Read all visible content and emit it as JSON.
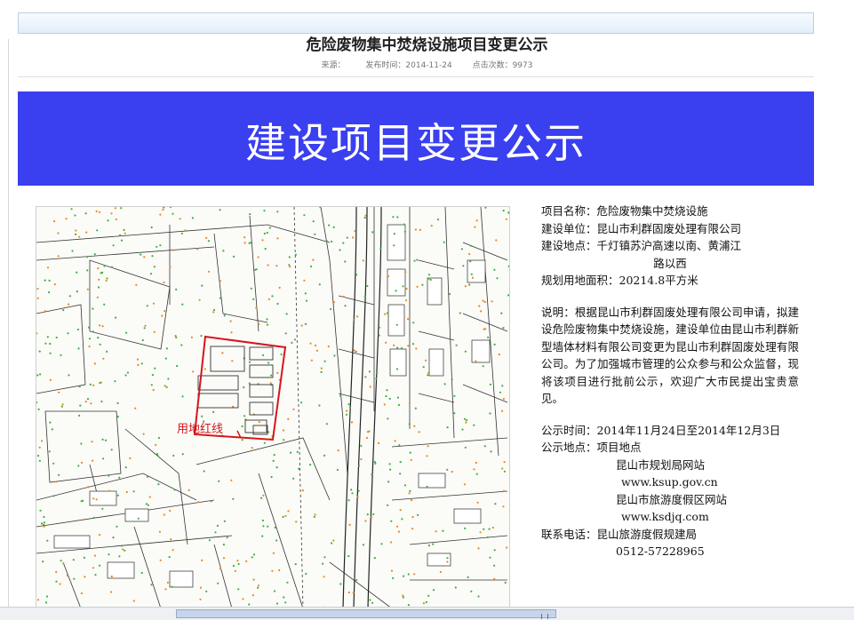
{
  "page": {
    "title": "危险废物集中焚烧设施项目变更公示",
    "meta_source": "来源：",
    "meta_date": "发布时间：2014-11-24",
    "meta_views": "点击次数：9973"
  },
  "banner": {
    "text": "建设项目变更公示"
  },
  "map": {
    "red_line_label": "用地红线"
  },
  "info": {
    "project_name": "项目名称：危险废物集中焚烧设施",
    "builder": "建设单位：昆山市利群固废处理有限公司",
    "location_1": "建设地点：千灯镇苏沪高速以南、黄浦江",
    "location_2": "路以西",
    "area": "规划用地面积：20214.8平方米",
    "explanation": "说明：根据昆山市利群固废处理有限公司申请，拟建设危险废物集中焚烧设施，建设单位由昆山市利群新型墙体材料有限公司变更为昆山市利群固废处理有限公司。为了加强城市管理的公众参与和公众监督，现将该项目进行批前公示，欢迎广大市民提出宝贵意见。",
    "time": "公示时间：2014年11月24日至2014年12月3日",
    "place_label": "公示地点：项目地点",
    "place_2": "昆山市规划局网站",
    "place_2_url": "www.ksup.gov.cn",
    "place_3": "昆山市旅游度假区网站",
    "place_3_url": "www.ksdjq.com",
    "phone_label": "联系电话：昆山旅游度假规建局",
    "phone": "0512-57228965"
  },
  "colors": {
    "banner": "#3a3ff0",
    "red_line": "#d4161b",
    "dots_green": "#3fae3f",
    "dots_orange": "#e8891c"
  }
}
